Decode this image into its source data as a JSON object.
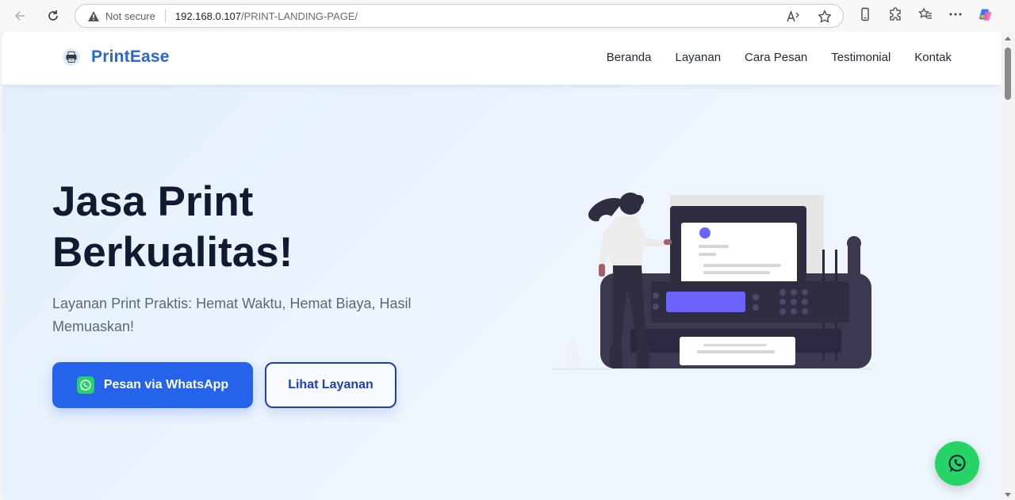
{
  "browser": {
    "security_label": "Not secure",
    "url_host": "192.168.0.107",
    "url_path": "/PRINT-LANDING-PAGE/",
    "icons": [
      "back-icon",
      "reload-icon",
      "warning-icon",
      "read-aloud-icon",
      "favorite-star-icon",
      "phone-icon",
      "extensions-icon",
      "favorites-icon",
      "more-icon",
      "copilot-icon"
    ]
  },
  "site": {
    "brand": "PrintEase",
    "nav": [
      "Beranda",
      "Layanan",
      "Cara Pesan",
      "Testimonial",
      "Kontak"
    ]
  },
  "hero": {
    "title_line1": "Jasa Print",
    "title_line2": "Berkualitas!",
    "subtitle": "Layanan Print Praktis: Hemat Waktu, Hemat Biaya, Hasil Memuaskan!",
    "primary_button": "Pesan via WhatsApp",
    "secondary_button": "Lihat Layanan"
  },
  "colors": {
    "brand_blue": "#2b63d9",
    "primary_button": "#2563eb",
    "secondary_border": "#1e40af",
    "whatsapp_green": "#25d366",
    "printer_dark": "#3b384f",
    "accent_purple": "#6c63ff"
  }
}
